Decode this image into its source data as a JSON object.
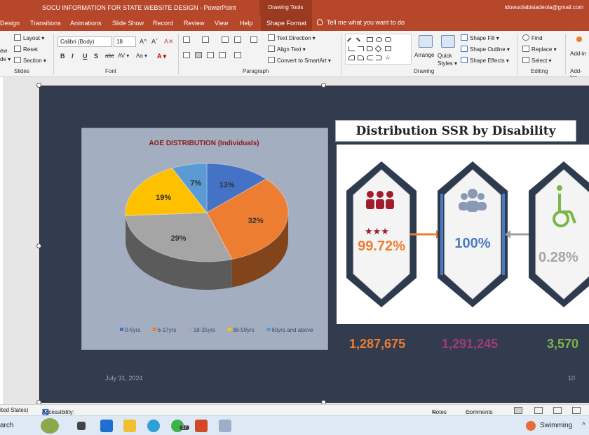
{
  "window": {
    "title": "SOCU INFORMATION FOR STATE WEBSITE DESIGN  -  PowerPoint",
    "context_tools": "Drawing Tools",
    "account": "idowuolabisiadeola@gmail.com"
  },
  "tabs": [
    "Design",
    "Transitions",
    "Animations",
    "Slide Show",
    "Record",
    "Review",
    "View",
    "Help",
    "Shape Format"
  ],
  "tell_me": "Tell me what you want to do",
  "ribbon": {
    "slides": {
      "left_top": "ew",
      "left_bottom": "de ▾",
      "layout": "Layout ▾",
      "reset": "Reset",
      "section": "Section ▾",
      "label": "Slides"
    },
    "font": {
      "name": "Calibri (Body)",
      "size": "18",
      "label": "Font",
      "grow": "A^",
      "shrink": "Aˇ",
      "clear": "A✕",
      "bold": "B",
      "italic": "I",
      "underline": "U",
      "shadow": "S",
      "strike": "abc",
      "spacing": "AV ▾",
      "case": "Aa ▾",
      "color": "A ▾"
    },
    "paragraph": {
      "text_direction": "Text Direction ▾",
      "align_text": "Align Text ▾",
      "convert_smartart": "Convert to SmartArt ▾",
      "label": "Paragraph"
    },
    "drawing": {
      "arrange": "Arrange",
      "quick_styles": "Quick Styles ▾",
      "shape_fill": "Shape Fill ▾",
      "shape_outline": "Shape Outline ▾",
      "shape_effects": "Shape Effects ▾",
      "label": "Drawing"
    },
    "editing": {
      "find": "Find",
      "replace": "Replace ▾",
      "select": "Select ▾",
      "label": "Editing"
    },
    "addins": {
      "button": "Add-in",
      "label": "Add-ins"
    }
  },
  "slide": {
    "pie_chart": {
      "title": "AGE DISTRIBUTION (Individuals)"
    },
    "ssr": {
      "title": "Distribution SSR by Disability",
      "percent_left": "99.72%",
      "percent_mid": "100%",
      "percent_right": "0.28%",
      "total_left": "1,287,675",
      "total_mid": "1,291,245",
      "total_right": "3,570"
    },
    "date": "July 31, 2024",
    "page_number": "10"
  },
  "chart_data": {
    "type": "pie",
    "title": "AGE DISTRIBUTION (Individuals)",
    "categories": [
      "0-5yrs",
      "6-17yrs",
      "18-35yrs",
      "36-59yrs",
      "60yrs and above"
    ],
    "values": [
      13,
      32,
      29,
      19,
      7
    ],
    "value_labels": [
      "13%",
      "32%",
      "29%",
      "19%",
      "7%"
    ],
    "colors": [
      "#4472c4",
      "#ed7d31",
      "#a5a5a5",
      "#ffc000",
      "#5b9bd5"
    ],
    "legend": "bottom"
  },
  "statusbar": {
    "language": "ited States)",
    "accessibility": "Accessibility: Investigate",
    "notes": "Notes",
    "comments": "Comments"
  },
  "taskbar": {
    "search": "arch",
    "weather": "Swimming",
    "whatsapp_badge": "17"
  }
}
